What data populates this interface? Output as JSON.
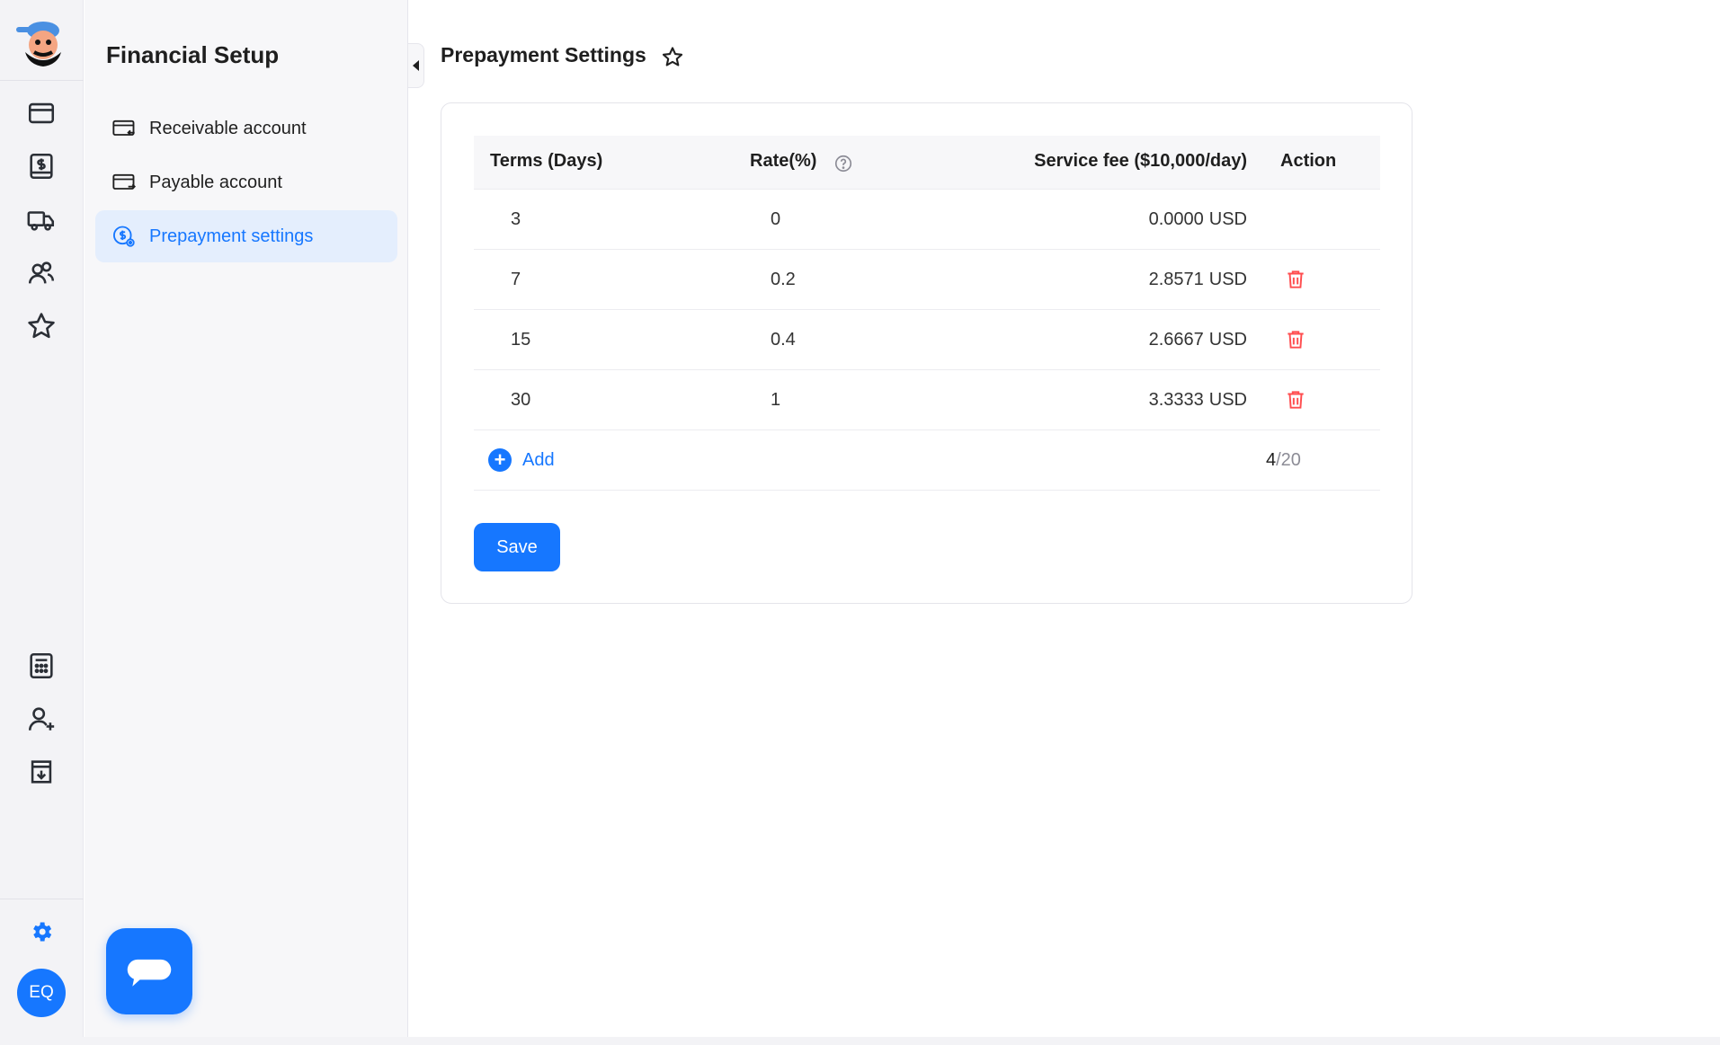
{
  "sub_sidebar": {
    "title": "Financial Setup",
    "items": [
      {
        "label": "Receivable account",
        "icon": "card-in-icon"
      },
      {
        "label": "Payable account",
        "icon": "card-out-icon"
      },
      {
        "label": "Prepayment settings",
        "icon": "dollar-gear-icon",
        "active": true
      }
    ]
  },
  "rail": {
    "avatar_initials": "EQ",
    "icons": [
      "wallet-icon",
      "dollar-doc-icon",
      "truck-icon",
      "users-icon",
      "star-icon",
      "calculator-icon",
      "add-user-icon",
      "download-doc-icon",
      "gear-icon"
    ]
  },
  "page": {
    "title": "Prepayment Settings"
  },
  "table": {
    "headers": {
      "terms": "Terms (Days)",
      "rate": "Rate(%)",
      "fee": "Service fee",
      "fee_note": "($10,000/day)",
      "action": "Action"
    },
    "rows": [
      {
        "terms": "3",
        "rate": "0",
        "fee": "0.0000",
        "unit": "USD",
        "deletable": false
      },
      {
        "terms": "7",
        "rate": "0.2",
        "fee": "2.8571",
        "unit": "USD",
        "deletable": true
      },
      {
        "terms": "15",
        "rate": "0.4",
        "fee": "2.6667",
        "unit": "USD",
        "deletable": true
      },
      {
        "terms": "30",
        "rate": "1",
        "fee": "3.3333",
        "unit": "USD",
        "deletable": true
      }
    ],
    "add_label": "Add",
    "count_current": "4",
    "count_max": "/20"
  },
  "save_label": "Save",
  "colors": {
    "accent": "#1677ff",
    "danger": "#ff4d4f"
  }
}
